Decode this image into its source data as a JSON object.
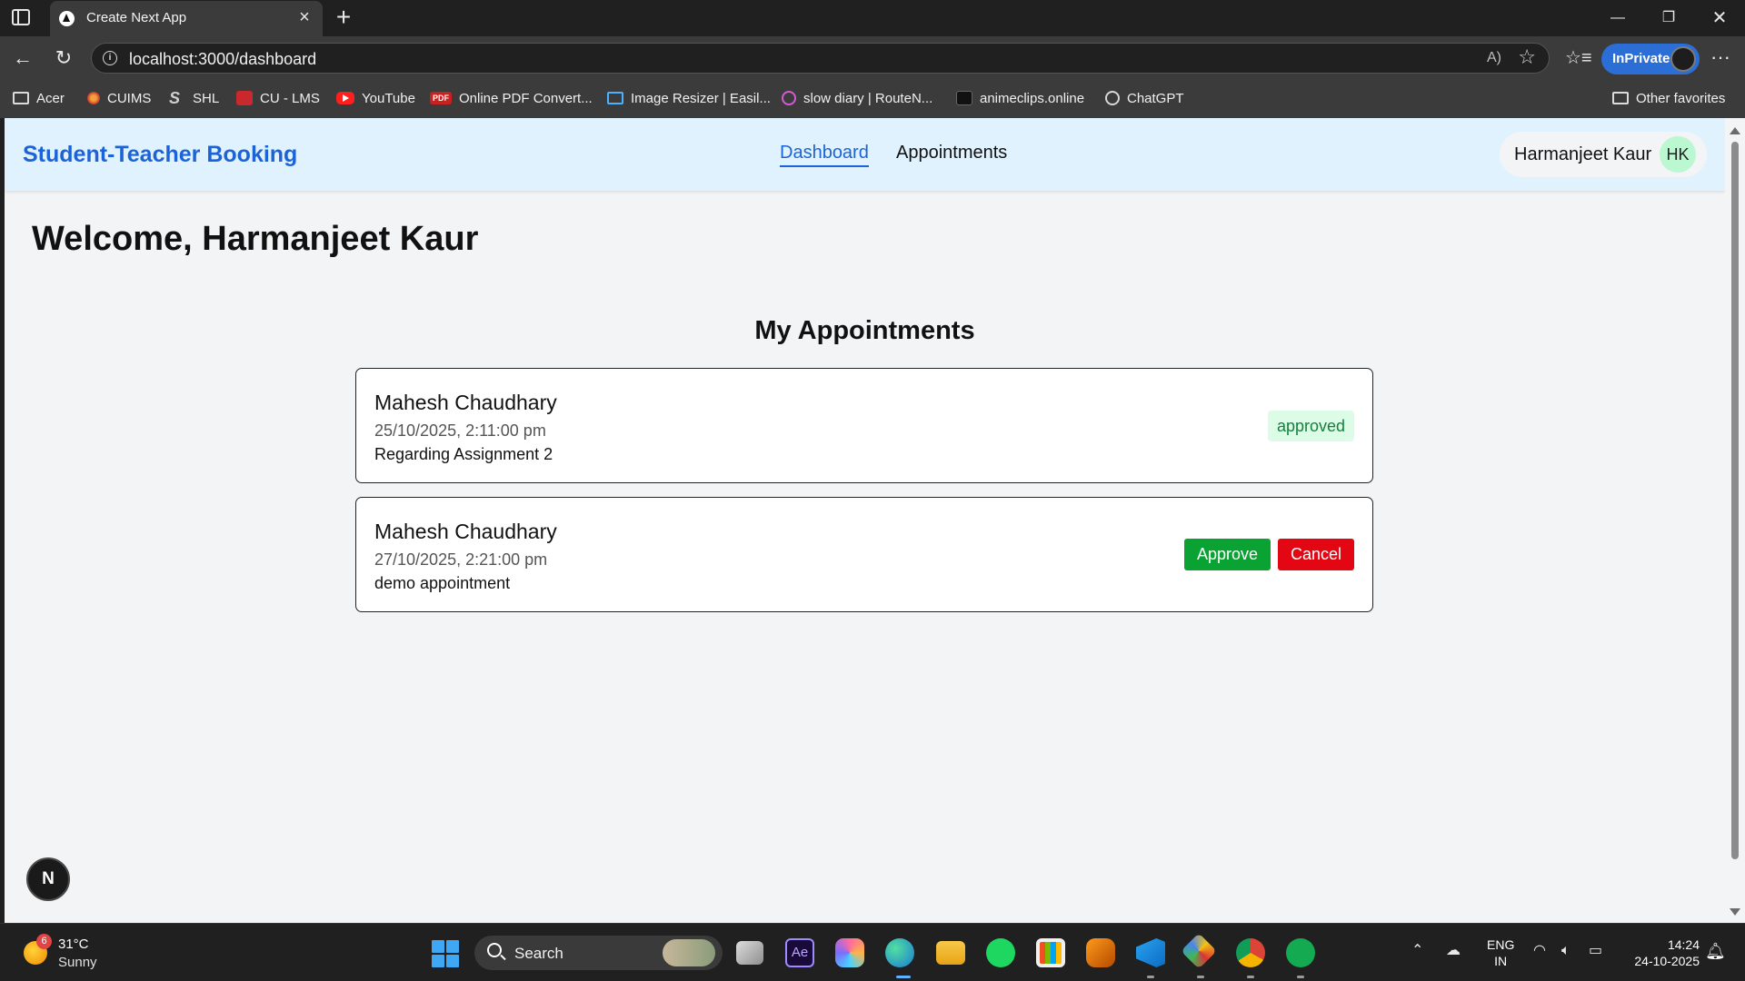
{
  "browser": {
    "tab_title": "Create Next App",
    "url": "localhost:3000/dashboard",
    "inprivate_label": "InPrivate",
    "bookmarks": [
      {
        "label": "Acer",
        "icon": "folder-icon"
      },
      {
        "label": "CUIMS",
        "icon": "cuims-icon"
      },
      {
        "label": "SHL",
        "icon": "shl-icon"
      },
      {
        "label": "CU - LMS",
        "icon": "culms-icon"
      },
      {
        "label": "YouTube",
        "icon": "youtube-icon"
      },
      {
        "label": "Online PDF Convert...",
        "icon": "pdf-icon"
      },
      {
        "label": "Image Resizer | Easil...",
        "icon": "image-resizer-icon"
      },
      {
        "label": "slow diary | RouteN...",
        "icon": "slow-diary-icon"
      },
      {
        "label": "animeclips.online",
        "icon": "animeclips-icon"
      },
      {
        "label": "ChatGPT",
        "icon": "chatgpt-icon"
      }
    ],
    "other_favorites": "Other favorites"
  },
  "app": {
    "brand": "Student-Teacher Booking",
    "nav": [
      {
        "label": "Dashboard",
        "active": true
      },
      {
        "label": "Appointments",
        "active": false
      }
    ],
    "user": {
      "name": "Harmanjeet Kaur",
      "initials": "HK"
    },
    "welcome": "Welcome, Harmanjeet Kaur",
    "section_title": "My Appointments",
    "appointments": [
      {
        "teacher": "Mahesh Chaudhary",
        "datetime": "25/10/2025, 2:11:00 pm",
        "reason": "Regarding Assignment 2",
        "status": "approved"
      },
      {
        "teacher": "Mahesh Chaudhary",
        "datetime": "27/10/2025, 2:21:00 pm",
        "reason": "demo appointment",
        "actions": {
          "approve": "Approve",
          "cancel": "Cancel"
        }
      }
    ],
    "next_badge": "N"
  },
  "taskbar": {
    "weather": {
      "badge": "6",
      "temp": "31°C",
      "condition": "Sunny"
    },
    "search_label": "Search",
    "lang_line1": "ENG",
    "lang_line2": "IN",
    "time": "14:24",
    "date": "24-10-2025"
  },
  "colors": {
    "brand": "#1d63d8",
    "navbar_bg": "#e0f2fe",
    "approve": "#0ba234",
    "cancel": "#e30713",
    "status_approved_bg": "#dcfce7",
    "status_approved_text": "#15803d"
  }
}
